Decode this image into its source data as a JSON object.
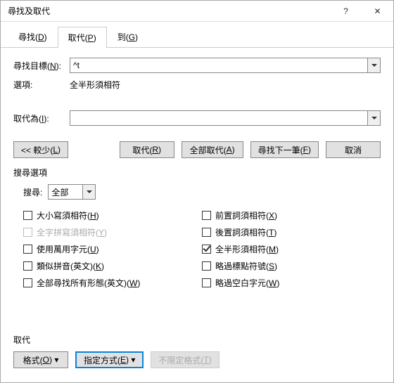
{
  "title": "尋找及取代",
  "titlebar": {
    "help": "?",
    "close": "✕"
  },
  "tabs": [
    {
      "label": "尋找(",
      "key": "D",
      "suffix": ")"
    },
    {
      "label": "取代(",
      "key": "P",
      "suffix": ")"
    },
    {
      "label": "到(",
      "key": "G",
      "suffix": ")"
    }
  ],
  "fields": {
    "find_label_pre": "尋找目標(",
    "find_key": "N",
    "find_label_post": "):",
    "find_value": "^t",
    "options_label": "選項:",
    "options_value": "全半形須相符",
    "replace_label_pre": "取代為(",
    "replace_key": "I",
    "replace_label_post": "):",
    "replace_value": ""
  },
  "buttons": {
    "less_pre": "<< 較少(",
    "less_key": "L",
    "less_post": ")",
    "replace_pre": "取代(",
    "replace_key": "R",
    "replace_post": ")",
    "replace_all_pre": "全部取代(",
    "replace_all_key": "A",
    "replace_all_post": ")",
    "find_next_pre": "尋找下一筆(",
    "find_next_key": "F",
    "find_next_post": ")",
    "cancel": "取消"
  },
  "search_section": "搜尋選項",
  "search_dir_label": "搜尋:",
  "search_dir_value": "全部",
  "checks_left": [
    {
      "label_pre": "大小寫須相符(",
      "key": "H",
      "label_post": ")",
      "checked": false,
      "disabled": false
    },
    {
      "label_pre": "全字拼寫須相符(",
      "key": "Y",
      "label_post": ")",
      "checked": false,
      "disabled": true
    },
    {
      "label_pre": "使用萬用字元(",
      "key": "U",
      "label_post": ")",
      "checked": false,
      "disabled": false
    },
    {
      "label_pre": "類似拼音(英文)(",
      "key": "K",
      "label_post": ")",
      "checked": false,
      "disabled": false
    },
    {
      "label_pre": "全部尋找所有形態(英文)(",
      "key": "W",
      "label_post": ")",
      "checked": false,
      "disabled": false
    }
  ],
  "checks_right": [
    {
      "label_pre": "前置詞須相符(",
      "key": "X",
      "label_post": ")",
      "checked": false,
      "disabled": false
    },
    {
      "label_pre": "後置詞須相符(",
      "key": "T",
      "label_post": ")",
      "checked": false,
      "disabled": false
    },
    {
      "label_pre": "全半形須相符(",
      "key": "M",
      "label_post": ")",
      "checked": true,
      "disabled": false
    },
    {
      "label_pre": "略過標點符號(",
      "key": "S",
      "label_post": ")",
      "checked": false,
      "disabled": false
    },
    {
      "label_pre": "略過空白字元(",
      "key": "W",
      "label_post": ")",
      "checked": false,
      "disabled": false
    }
  ],
  "footer": {
    "section": "取代",
    "format_pre": "格式(",
    "format_key": "O",
    "format_post": ") ▾",
    "special_pre": "指定方式(",
    "special_key": "E",
    "special_post": ") ▾",
    "noformat_pre": "不限定格式(",
    "noformat_key": "T",
    "noformat_post": ")"
  }
}
